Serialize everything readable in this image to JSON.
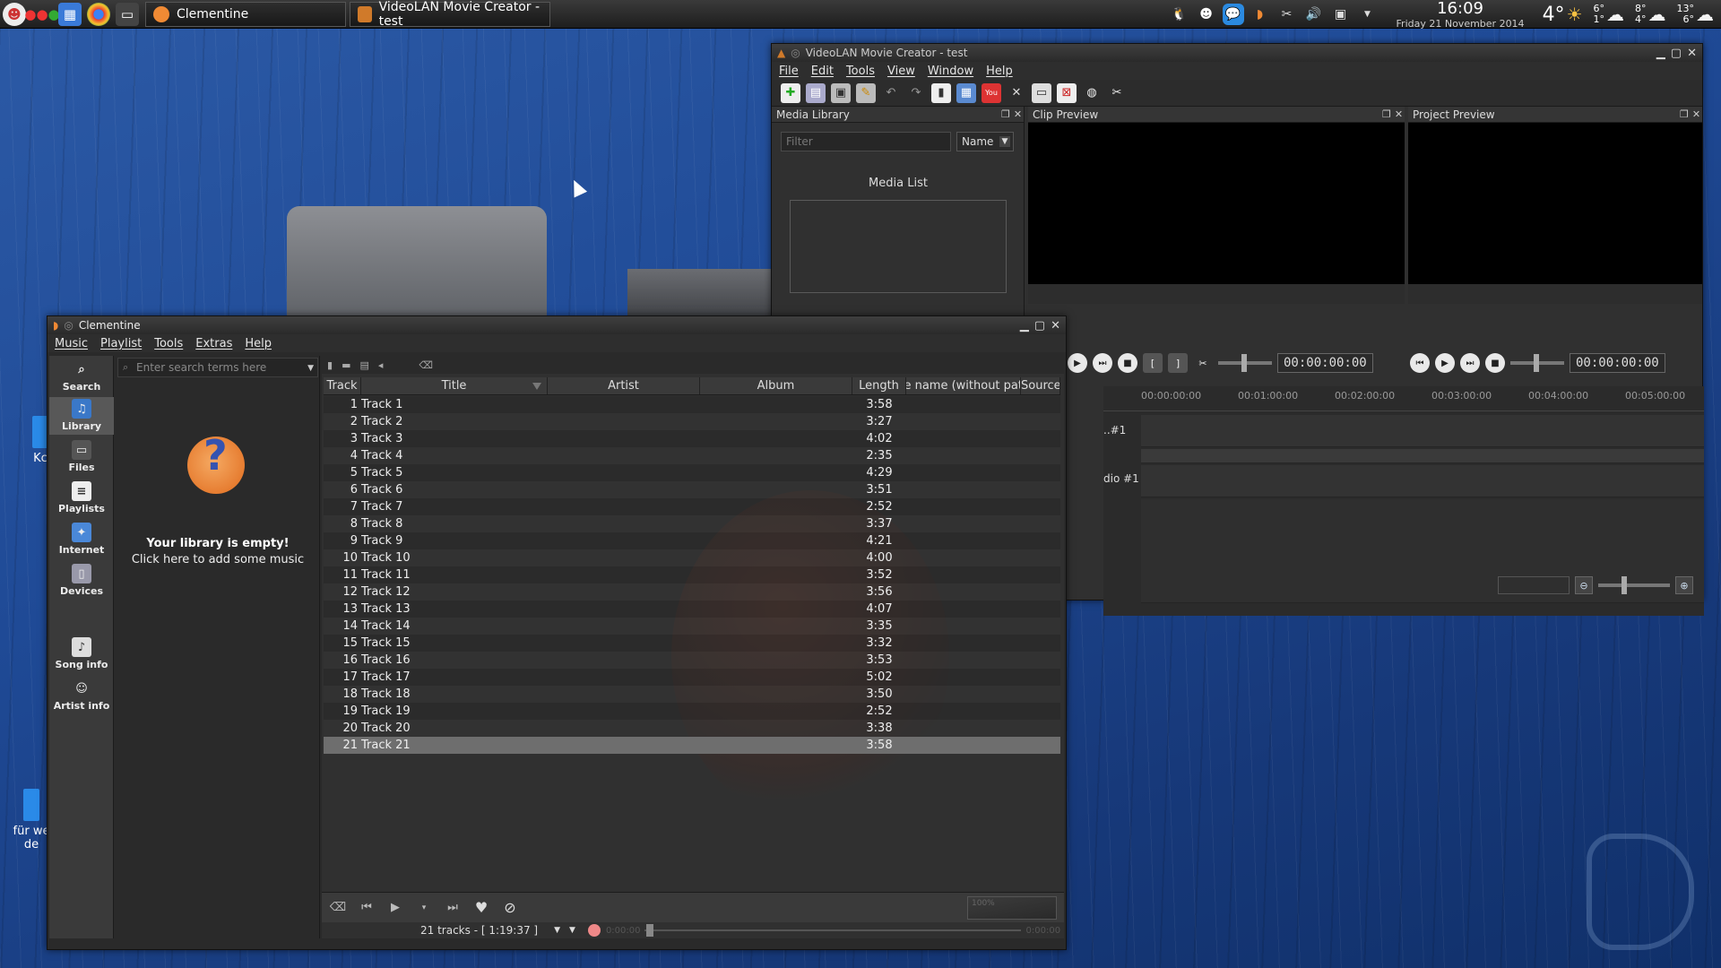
{
  "taskbar": {
    "tasks": [
      {
        "label": "Clementine",
        "icon": "clementine-icon"
      },
      {
        "label": "VideoLAN Movie Creator - test",
        "icon": "vlmc-icon"
      }
    ],
    "clock_time": "16:09",
    "clock_date": "Friday 21 November 2014",
    "weather": {
      "current": "4°",
      "days": [
        {
          "high": "6°",
          "low": "1°"
        },
        {
          "high": "8°",
          "low": "4°"
        },
        {
          "high": "13°",
          "low": "6°"
        }
      ]
    }
  },
  "desktop": {
    "icons": [
      "Kc",
      "für we de"
    ]
  },
  "vlmc": {
    "title": "VideoLAN Movie Creator - test",
    "menu": [
      "File",
      "Edit",
      "Tools",
      "View",
      "Window",
      "Help"
    ],
    "media_library": {
      "title": "Media Library",
      "filter_placeholder": "Filter",
      "sort_value": "Name",
      "list_caption": "Media List"
    },
    "clip_preview": {
      "title": "Clip Preview",
      "time": "00:00:00:00"
    },
    "project_preview": {
      "title": "Project Preview",
      "time": "00:00:00:00"
    },
    "timeline": {
      "ruler": [
        "00:00:00:00",
        "00:01:00:00",
        "00:02:00:00",
        "00:03:00:00",
        "00:04:00:00",
        "00:05:00:00"
      ],
      "tracks": [
        "..#1",
        "dio #1"
      ]
    }
  },
  "clementine": {
    "title": "Clementine",
    "menu": [
      "Music",
      "Playlist",
      "Tools",
      "Extras",
      "Help"
    ],
    "sidebar": [
      "Search",
      "Library",
      "Files",
      "Playlists",
      "Internet",
      "Devices",
      "Song info",
      "Artist info"
    ],
    "search_placeholder": "Enter search terms here",
    "library_empty_title": "Your library is empty!",
    "library_empty_sub": "Click here to add some music",
    "columns": {
      "track": "Track",
      "title": "Title",
      "artist": "Artist",
      "album": "Album",
      "length": "Length",
      "file": "File name (without path)",
      "source": "Source"
    },
    "tracks": [
      {
        "n": "1",
        "title": "Track 1",
        "length": "3:58"
      },
      {
        "n": "2",
        "title": "Track 2",
        "length": "3:27"
      },
      {
        "n": "3",
        "title": "Track 3",
        "length": "4:02"
      },
      {
        "n": "4",
        "title": "Track 4",
        "length": "2:35"
      },
      {
        "n": "5",
        "title": "Track 5",
        "length": "4:29"
      },
      {
        "n": "6",
        "title": "Track 6",
        "length": "3:51"
      },
      {
        "n": "7",
        "title": "Track 7",
        "length": "2:52"
      },
      {
        "n": "8",
        "title": "Track 8",
        "length": "3:37"
      },
      {
        "n": "9",
        "title": "Track 9",
        "length": "4:21"
      },
      {
        "n": "10",
        "title": "Track 10",
        "length": "4:00"
      },
      {
        "n": "11",
        "title": "Track 11",
        "length": "3:52"
      },
      {
        "n": "12",
        "title": "Track 12",
        "length": "3:56"
      },
      {
        "n": "13",
        "title": "Track 13",
        "length": "4:07"
      },
      {
        "n": "14",
        "title": "Track 14",
        "length": "3:35"
      },
      {
        "n": "15",
        "title": "Track 15",
        "length": "3:32"
      },
      {
        "n": "16",
        "title": "Track 16",
        "length": "3:53"
      },
      {
        "n": "17",
        "title": "Track 17",
        "length": "5:02"
      },
      {
        "n": "18",
        "title": "Track 18",
        "length": "3:50"
      },
      {
        "n": "19",
        "title": "Track 19",
        "length": "2:52"
      },
      {
        "n": "20",
        "title": "Track 20",
        "length": "3:38"
      },
      {
        "n": "21",
        "title": "Track 21",
        "length": "3:58"
      }
    ],
    "selected_track": "21",
    "status": "21 tracks - [ 1:19:37 ]",
    "elapsed": "0:00:00",
    "remaining": "0:00:00",
    "volume": "100%"
  }
}
